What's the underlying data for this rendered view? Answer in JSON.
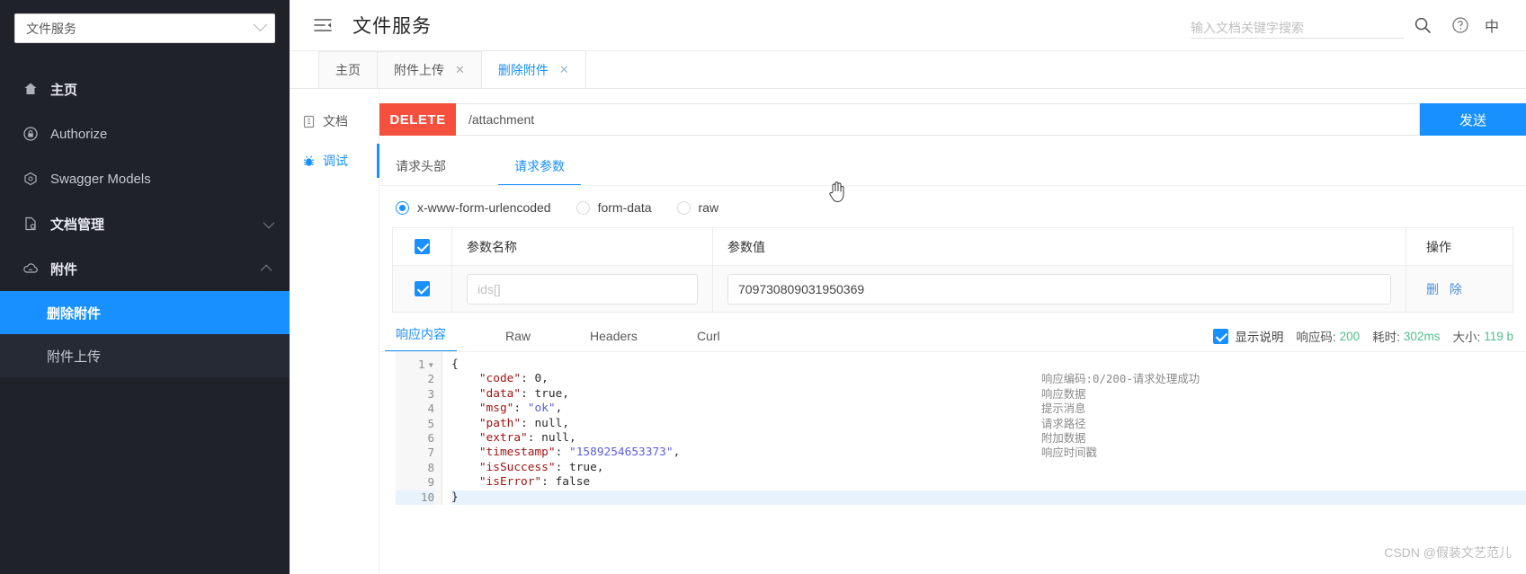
{
  "sidebar": {
    "project_selector": {
      "value": "文件服务",
      "icon": "chevron-down-icon"
    },
    "items": [
      {
        "label": "主页",
        "icon": "home-icon",
        "bold": true,
        "arrow": null
      },
      {
        "label": "Authorize",
        "icon": "lock-icon",
        "bold": false,
        "arrow": null
      },
      {
        "label": "Swagger Models",
        "icon": "model-icon",
        "bold": false,
        "arrow": null
      },
      {
        "label": "文档管理",
        "icon": "doc-manage-icon",
        "bold": true,
        "arrow": "down"
      },
      {
        "label": "附件",
        "icon": "cloud-icon",
        "bold": true,
        "arrow": "up"
      }
    ],
    "sub_items": [
      {
        "label": "删除附件",
        "active": true
      },
      {
        "label": "附件上传",
        "active": false
      }
    ]
  },
  "topbar": {
    "collapse_icon": "collapse-menu-icon",
    "title": "文件服务",
    "search": {
      "placeholder": "输入文档关键字搜索",
      "value": ""
    },
    "search_icon": "search-icon",
    "help_icon": "help-circle-icon",
    "lang": "中"
  },
  "page_tabs": [
    {
      "label": "主页",
      "closable": false,
      "active": false
    },
    {
      "label": "附件上传",
      "closable": true,
      "active": false
    },
    {
      "label": "删除附件",
      "closable": true,
      "active": true
    }
  ],
  "doc_side": [
    {
      "label": "文档",
      "icon": "document-icon",
      "active": false
    },
    {
      "label": "调试",
      "icon": "bug-icon",
      "active": true
    }
  ],
  "request": {
    "method": "DELETE",
    "url": "/attachment",
    "send_label": "发送",
    "tabs": [
      {
        "label": "请求头部",
        "active": false
      },
      {
        "label": "请求参数",
        "active": true
      }
    ],
    "body_types": [
      {
        "label": "x-www-form-urlencoded",
        "selected": true
      },
      {
        "label": "form-data",
        "selected": false
      },
      {
        "label": "raw",
        "selected": false
      }
    ],
    "table": {
      "headers": {
        "name": "参数名称",
        "value": "参数值",
        "action": "操作"
      },
      "header_checked": true,
      "rows": [
        {
          "checked": true,
          "name_value": "",
          "name_placeholder": "ids[]",
          "value_value": "709730809031950369",
          "action_label": "删 除"
        }
      ]
    }
  },
  "response": {
    "tabs": [
      {
        "label": "响应内容",
        "active": true
      },
      {
        "label": "Raw",
        "active": false
      },
      {
        "label": "Headers",
        "active": false
      },
      {
        "label": "Curl",
        "active": false
      }
    ],
    "show_desc_checked": true,
    "show_desc_label": "显示说明",
    "status_label": "响应码:",
    "status_value": "200",
    "time_label": "耗时:",
    "time_value": "302ms",
    "size_label": "大小:",
    "size_value": "119 b",
    "line_numbers": [
      "1",
      "2",
      "3",
      "4",
      "5",
      "6",
      "7",
      "8",
      "9",
      "10"
    ],
    "code_lines": [
      "{",
      "    \"code\": 0,",
      "    \"data\": true,",
      "    \"msg\": \"ok\",",
      "    \"path\": null,",
      "    \"extra\": null,",
      "    \"timestamp\": \"1589254653373\",",
      "    \"isSuccess\": true,",
      "    \"isError\": false",
      "}"
    ],
    "annotations": [
      "",
      "响应编码:0/200-请求处理成功",
      "响应数据",
      "提示消息",
      "请求路径",
      "附加数据",
      "响应时间戳"
    ]
  },
  "watermark": "CSDN @假装文艺范儿",
  "colors": {
    "accent": "#1890ff",
    "delete_red": "#f5503e",
    "sidebar_bg": "#20222a",
    "status_green": "#4fc08d"
  }
}
